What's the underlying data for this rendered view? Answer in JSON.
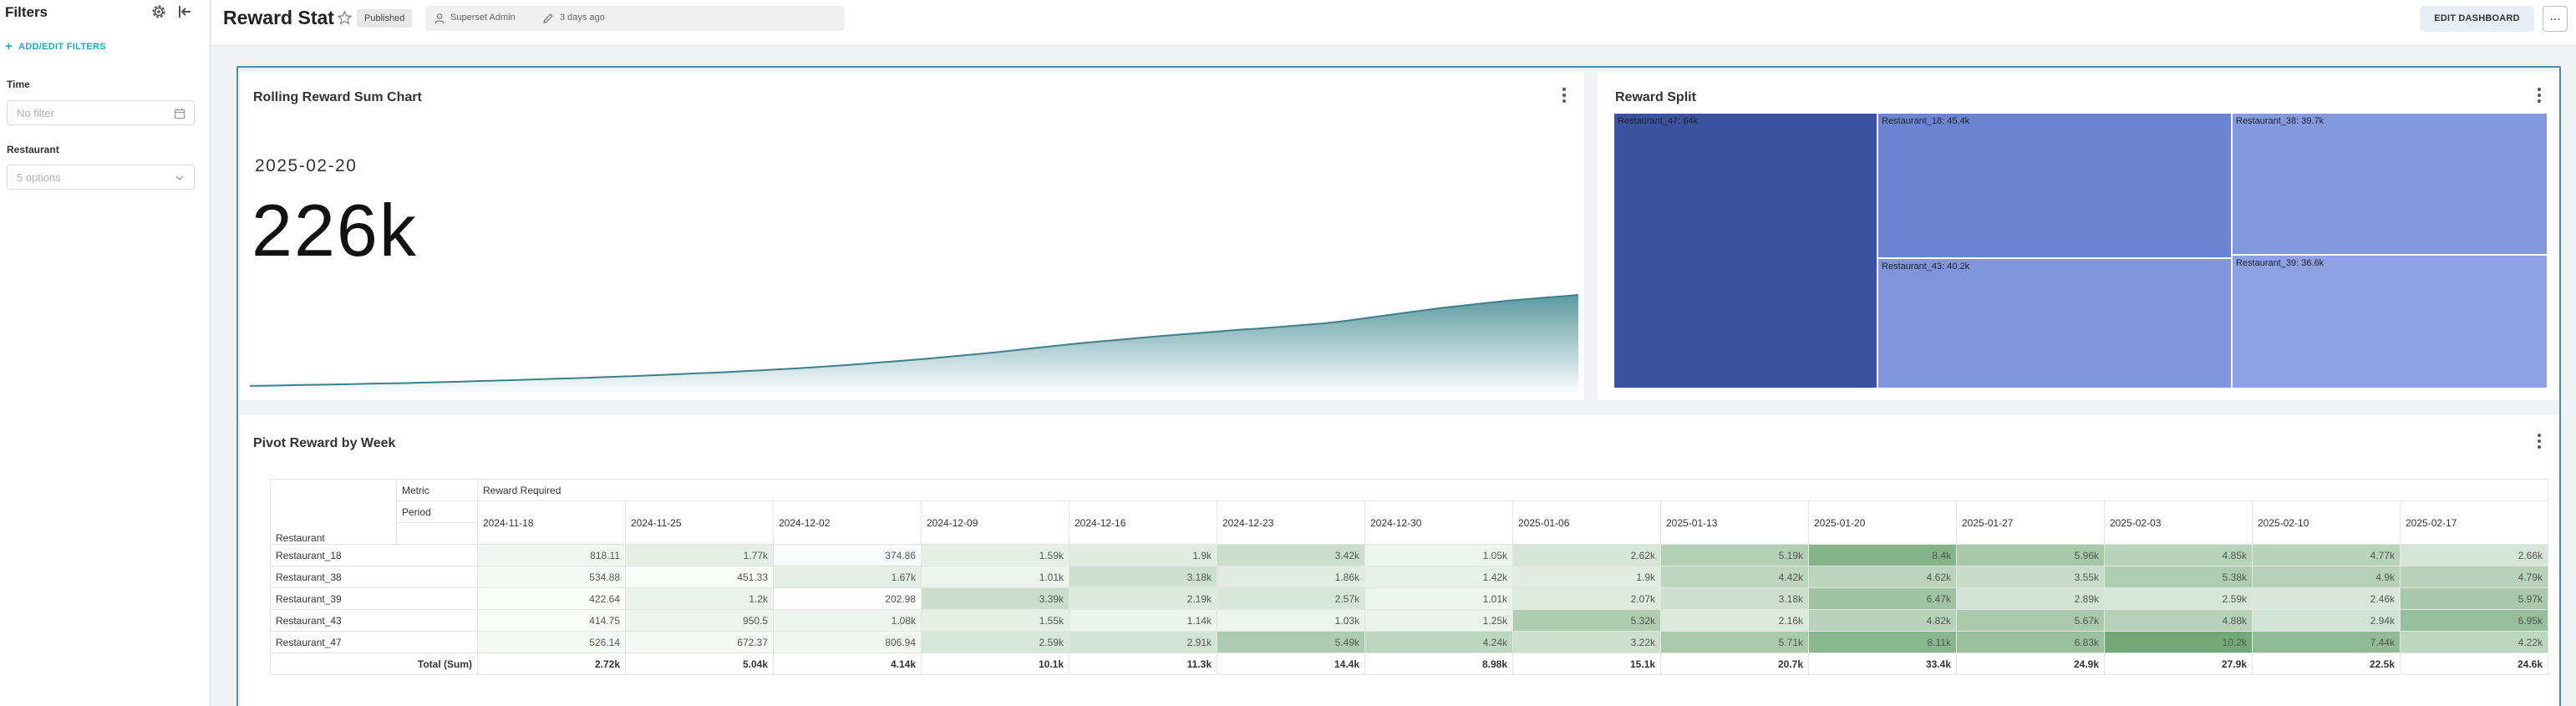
{
  "sidebar": {
    "title": "Filters",
    "add_label": "ADD/EDIT FILTERS",
    "filters": [
      {
        "label": "Time",
        "placeholder": "No filter"
      },
      {
        "label": "Restaurant",
        "placeholder": "5 options"
      }
    ]
  },
  "header": {
    "title": "Reward Stat",
    "status": "Published",
    "owner": "Superset Admin",
    "modified": "3 days ago",
    "edit_label": "EDIT DASHBOARD",
    "more_label": "..."
  },
  "big_number": {
    "title": "Rolling Reward Sum Chart",
    "date": "2025-02-20",
    "value": "226k",
    "colors": {
      "line": "#3d7f8c",
      "fill": "#5b9aa3"
    },
    "trend": [
      0.01,
      0.013,
      0.016,
      0.02,
      0.023,
      0.026,
      0.03,
      0.034,
      0.037,
      0.04,
      0.045,
      0.05,
      0.055,
      0.06,
      0.066,
      0.07,
      0.076,
      0.082,
      0.088,
      0.094,
      0.1,
      0.107,
      0.114,
      0.12,
      0.128,
      0.136,
      0.145,
      0.153,
      0.16,
      0.17,
      0.18,
      0.19,
      0.2,
      0.212,
      0.224,
      0.236,
      0.25,
      0.265,
      0.28,
      0.295,
      0.31,
      0.327,
      0.345,
      0.362,
      0.38,
      0.4,
      0.42,
      0.44,
      0.46,
      0.478,
      0.495,
      0.512,
      0.528,
      0.545,
      0.56,
      0.575,
      0.59,
      0.605,
      0.62,
      0.632,
      0.645,
      0.66,
      0.675,
      0.69,
      0.71,
      0.735,
      0.76,
      0.785,
      0.81,
      0.835,
      0.86,
      0.88,
      0.9,
      0.92,
      0.94,
      0.955,
      0.97,
      0.985,
      1.0
    ]
  },
  "treemap": {
    "title": "Reward Split",
    "cells": [
      {
        "label": "Restaurant_47: 64k",
        "color": "#3a52a0"
      },
      {
        "label": "Restaurant_18: 45.4k",
        "color": "#6b85d4"
      },
      {
        "label": "Restaurant_43: 40.2k",
        "color": "#7f96dd"
      },
      {
        "label": "Restaurant_38: 39.7k",
        "color": "#8499df"
      },
      {
        "label": "Restaurant_39: 36.6k",
        "color": "#8ea1e1"
      }
    ]
  },
  "pivot": {
    "title": "Pivot Reward by Week",
    "metric_label": "Metric",
    "metric_value": "Reward Required",
    "period_label": "Period",
    "row_header": "Restaurant",
    "columns": [
      "2024-11-18",
      "2024-11-25",
      "2024-12-02",
      "2024-12-09",
      "2024-12-16",
      "2024-12-23",
      "2024-12-30",
      "2025-01-06",
      "2025-01-13",
      "2025-01-20",
      "2025-01-27",
      "2025-02-03",
      "2025-02-10",
      "2025-02-17"
    ],
    "rows": [
      {
        "name": "Restaurant_18",
        "values": [
          "818.11",
          "1.77k",
          "374.86",
          "1.59k",
          "1.9k",
          "3.42k",
          "1.05k",
          "2.62k",
          "5.19k",
          "8.4k",
          "5.96k",
          "4.85k",
          "4.77k",
          "2.66k"
        ],
        "shade": [
          0.1,
          0.2,
          0.04,
          0.19,
          0.22,
          0.38,
          0.13,
          0.3,
          0.55,
          0.87,
          0.63,
          0.52,
          0.51,
          0.3
        ]
      },
      {
        "name": "Restaurant_38",
        "values": [
          "534.88",
          "451.33",
          "1.67k",
          "1.01k",
          "3.18k",
          "1.86k",
          "1.42k",
          "1.9k",
          "4.42k",
          "4.62k",
          "3.55k",
          "5.38k",
          "4.9k",
          "4.79k"
        ],
        "shade": [
          0.07,
          0.05,
          0.2,
          0.13,
          0.36,
          0.22,
          0.17,
          0.22,
          0.48,
          0.5,
          0.4,
          0.58,
          0.53,
          0.52
        ]
      },
      {
        "name": "Restaurant_39",
        "values": [
          "422.64",
          "1.2k",
          "202.98",
          "3.39k",
          "2.19k",
          "2.57k",
          "1.01k",
          "2.07k",
          "3.18k",
          "6.47k",
          "2.89k",
          "2.59k",
          "2.46k",
          "5.97k"
        ],
        "shade": [
          0.05,
          0.15,
          0.02,
          0.38,
          0.25,
          0.29,
          0.13,
          0.24,
          0.36,
          0.69,
          0.33,
          0.29,
          0.28,
          0.63
        ]
      },
      {
        "name": "Restaurant_43",
        "values": [
          "414.75",
          "950.5",
          "1.08k",
          "1.55k",
          "1.14k",
          "1.03k",
          "1.25k",
          "5.32k",
          "2.16k",
          "4.82k",
          "5.67k",
          "4.88k",
          "2.94k",
          "6.95k"
        ],
        "shade": [
          0.05,
          0.12,
          0.13,
          0.19,
          0.14,
          0.13,
          0.15,
          0.57,
          0.25,
          0.52,
          0.61,
          0.53,
          0.33,
          0.74
        ]
      },
      {
        "name": "Restaurant_47",
        "values": [
          "526.14",
          "672.37",
          "806.94",
          "2.59k",
          "2.91k",
          "5.49k",
          "4.24k",
          "3.22k",
          "5.71k",
          "8.11k",
          "6.83k",
          "10.2k",
          "7.44k",
          "4.22k"
        ],
        "shade": [
          0.07,
          0.08,
          0.1,
          0.29,
          0.33,
          0.59,
          0.47,
          0.36,
          0.61,
          0.84,
          0.72,
          1.0,
          0.79,
          0.47
        ]
      }
    ],
    "total_label": "Total (Sum)",
    "totals": [
      "2.72k",
      "5.04k",
      "4.14k",
      "10.1k",
      "11.3k",
      "14.4k",
      "8.98k",
      "15.1k",
      "20.7k",
      "33.4k",
      "24.9k",
      "27.9k",
      "22.5k",
      "24.6k"
    ],
    "heat_color": "#5a9a5f"
  }
}
